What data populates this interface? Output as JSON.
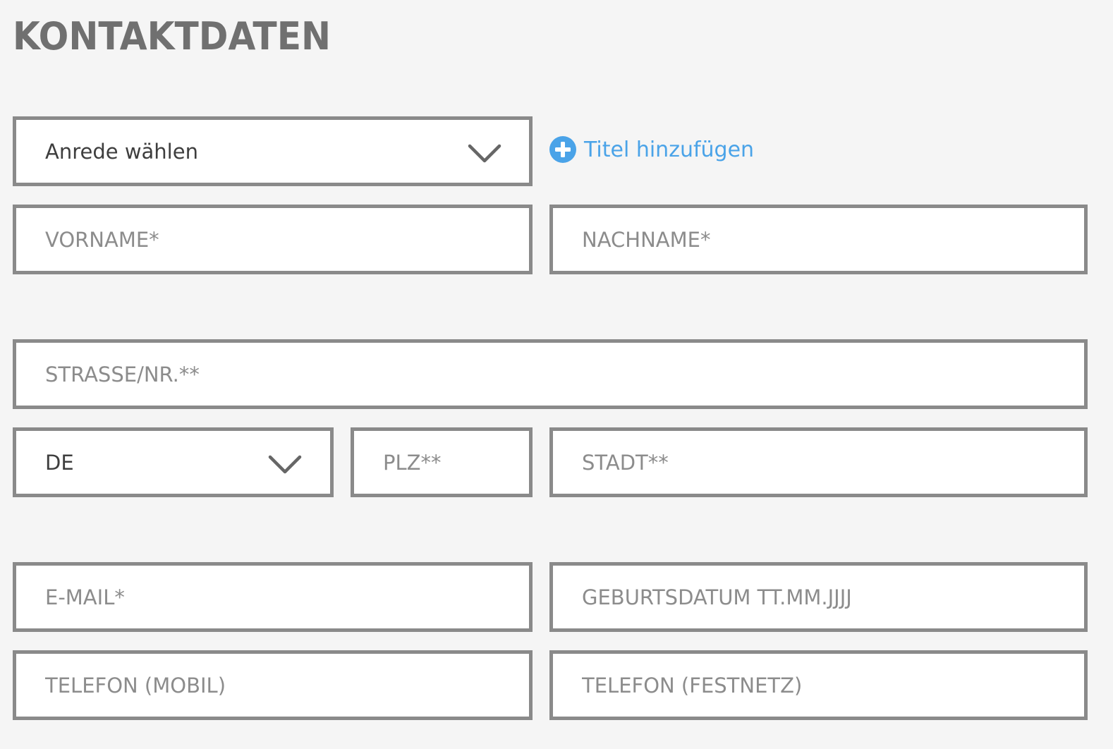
{
  "form": {
    "title": "KONTAKTDATEN",
    "salutation": {
      "value": "Anrede wählen"
    },
    "add_title_label": "Titel hinzufügen",
    "first_name": {
      "placeholder": "VORNAME*"
    },
    "last_name": {
      "placeholder": "NACHNAME*"
    },
    "street": {
      "placeholder": "STRASSE/NR.**"
    },
    "country": {
      "value": "DE"
    },
    "zip": {
      "placeholder": "PLZ**"
    },
    "city": {
      "placeholder": "STADT**"
    },
    "email": {
      "placeholder": "E-MAIL*"
    },
    "birthdate": {
      "placeholder": "GEBURTSDATUM TT.MM.JJJJ"
    },
    "phone_mobile": {
      "placeholder": "TELEFON (MOBIL)"
    },
    "phone_landline": {
      "placeholder": "TELEFON (FESTNETZ)"
    }
  },
  "colors": {
    "background": "#f5f5f5",
    "border": "#8a8a8a",
    "heading": "#707070",
    "placeholder": "#8c8c8c",
    "accent": "#4aa3e8"
  },
  "icons": {
    "dropdown": "chevron-down-icon",
    "add": "plus-circle-icon"
  }
}
